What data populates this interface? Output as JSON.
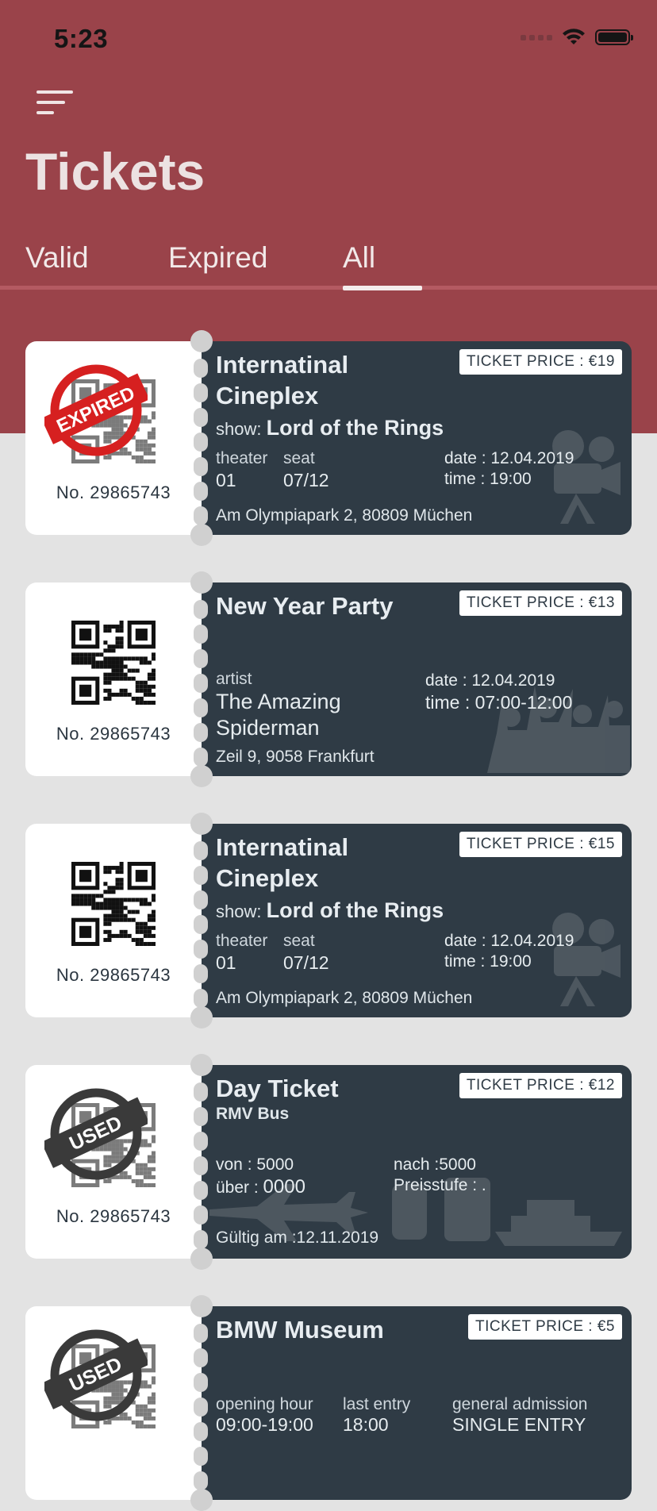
{
  "status_bar": {
    "time": "5:23"
  },
  "header": {
    "title": "Tickets"
  },
  "tabs": [
    {
      "label": "Valid"
    },
    {
      "label": "Expired"
    },
    {
      "label": "All"
    }
  ],
  "active_tab": "All",
  "tickets": [
    {
      "number": "No. 29865743",
      "stamp": "EXPIRED",
      "price": "TICKET PRICE : €19",
      "title_line1": "Internatinal",
      "title_line2": "Cineplex",
      "show_label": "show:",
      "show_value": "Lord of the Rings",
      "theater_label": "theater",
      "theater_value": "01",
      "seat_label": "seat",
      "seat_value": "07/12",
      "date": "date : 12.04.2019",
      "time": "time : 19:00",
      "address": "Am Olympiapark 2, 80809 Müchen",
      "watermark_icon": "camera-icon"
    },
    {
      "number": "No. 29865743",
      "price": "TICKET PRICE : €13",
      "title": "New Year Party",
      "artist_label": "artist",
      "artist_line1": "The Amazing",
      "artist_line2": "Spiderman",
      "date": "date : 12.04.2019",
      "time": "time : 07:00-12:00",
      "address": "Zeil 9, 9058 Frankfurt",
      "watermark_icon": "crowd-icon"
    },
    {
      "number": "No. 29865743",
      "price": "TICKET PRICE : €15",
      "title_line1": "Internatinal",
      "title_line2": "Cineplex",
      "show_label": "show:",
      "show_value": "Lord of the Rings",
      "theater_label": "theater",
      "theater_value": "01",
      "seat_label": "seat",
      "seat_value": "07/12",
      "date": "date : 12.04.2019",
      "time": "time : 19:00",
      "address": "Am Olympiapark 2, 80809 Müchen",
      "watermark_icon": "camera-icon"
    },
    {
      "number": "No. 29865743",
      "stamp": "USED",
      "price": "TICKET PRICE : €12",
      "title": "Day Ticket",
      "subtitle": "RMV Bus",
      "von": "von : 5000",
      "ueber_label": "über :",
      "ueber_value": "0000",
      "nach": "nach :5000",
      "preisstufe": "Preisstufe : .",
      "gueltig": "Gültig am :12.11.2019",
      "watermark_icon": "transport-icon"
    },
    {
      "stamp": "USED",
      "price": "TICKET PRICE : €5",
      "title": "BMW Museum",
      "opening_label": "opening hour",
      "opening_value": "09:00-19:00",
      "last_entry_label": "last entry",
      "last_entry_value": "18:00",
      "admission_label": "general admission",
      "admission_value": "SINGLE ENTRY"
    }
  ],
  "colors": {
    "header": "#9a434a",
    "ticket_body": "#2f3b45",
    "expired_stamp": "#d62020",
    "used_stamp": "#3a3a3a"
  }
}
